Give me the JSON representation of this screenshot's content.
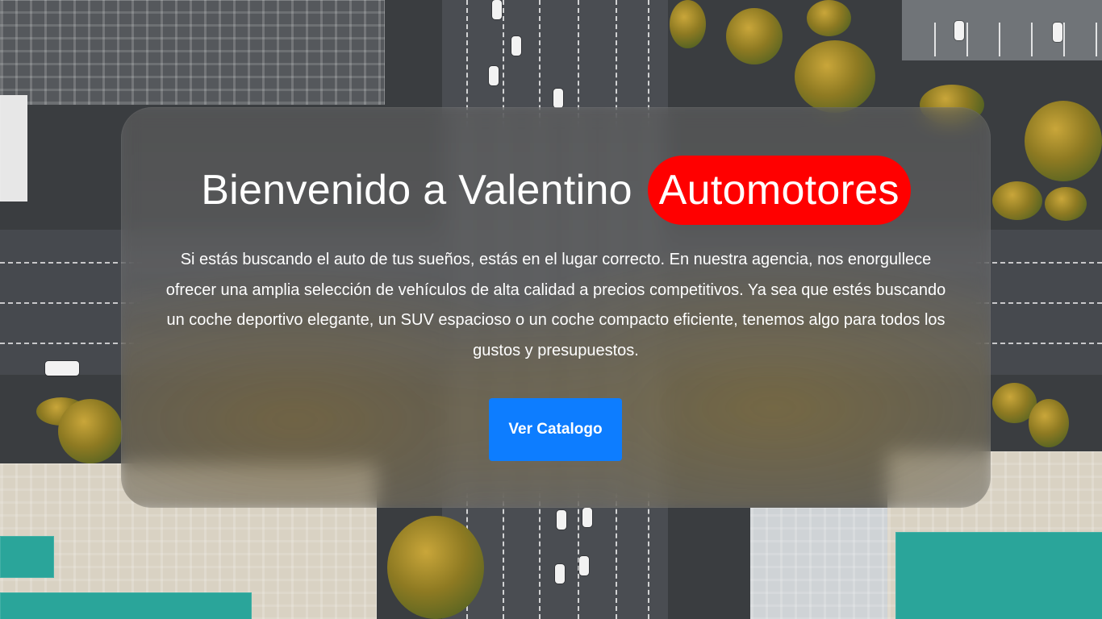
{
  "hero": {
    "title_prefix": "Bienvenido a Valentino",
    "title_brand": "Automotores",
    "description": "Si estás buscando el auto de tus sueños, estás en el lugar correcto. En nuestra agencia, nos enorgullece ofrecer una amplia selección de vehículos de alta calidad a precios competitivos. Ya sea que estés buscando un coche deportivo elegante, un SUV espacioso o un coche compacto eficiente, tenemos algo para todos los gustos y presupuestos.",
    "cta_label": "Ver Catalogo"
  },
  "colors": {
    "brand_badge": "#ff0000",
    "cta_button": "#0d7dff",
    "text": "#ffffff"
  }
}
